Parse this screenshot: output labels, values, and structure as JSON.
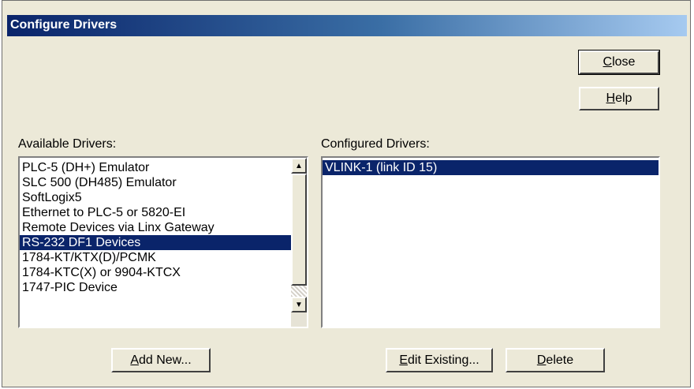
{
  "window": {
    "title": "Configure Drivers"
  },
  "buttons": {
    "close": {
      "accel": "C",
      "rest": "lose"
    },
    "help": {
      "accel": "H",
      "rest": "elp"
    },
    "add_new": {
      "accel": "A",
      "rest": "dd New..."
    },
    "edit_existing": {
      "accel": "E",
      "rest": "dit Existing..."
    },
    "delete": {
      "accel": "D",
      "rest": "elete"
    }
  },
  "available": {
    "label": "Available Drivers:",
    "items": [
      "PLC-5 (DH+) Emulator",
      "SLC 500 (DH485) Emulator",
      "SoftLogix5",
      "Ethernet to PLC-5 or 5820-EI",
      "Remote Devices via Linx Gateway",
      "RS-232 DF1 Devices",
      "1784-KT/KTX(D)/PCMK",
      "1784-KTC(X) or 9904-KTCX",
      "1747-PIC Device"
    ],
    "selected_index": 5
  },
  "configured": {
    "label": "Configured Drivers:",
    "items": [
      "VLINK-1 (link ID 15)"
    ],
    "selected_index": 0
  },
  "icons": {
    "scroll_up": "▲",
    "scroll_down": "▼"
  },
  "colors": {
    "selection": "#0a246a",
    "title_start": "#0a246a",
    "title_end": "#a6caf0"
  }
}
